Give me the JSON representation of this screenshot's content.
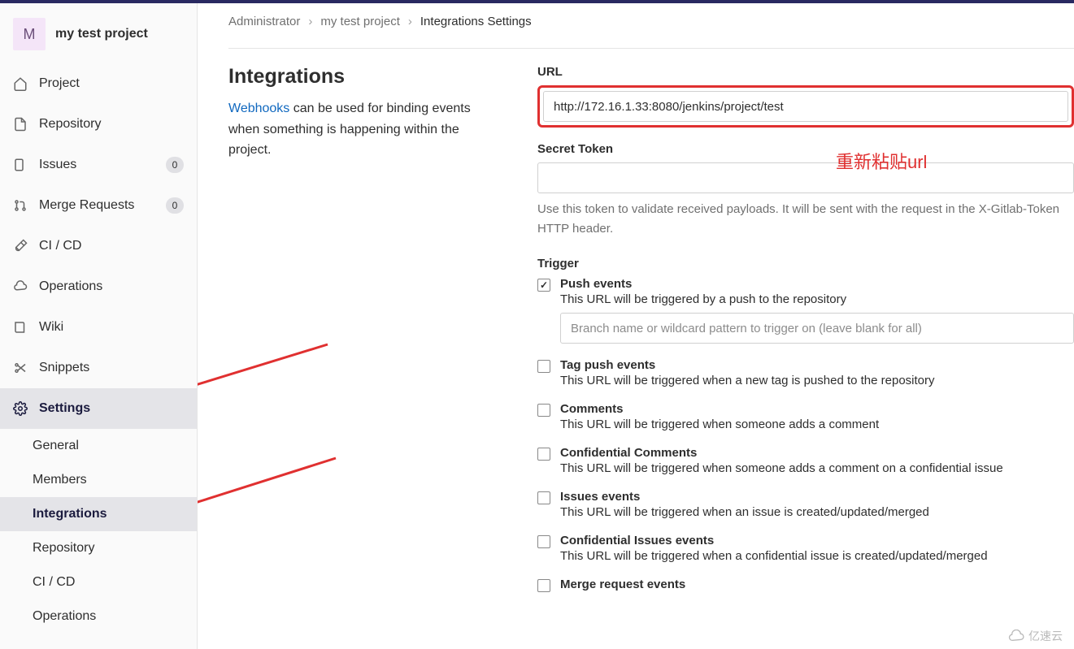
{
  "project": {
    "avatar_letter": "M",
    "name": "my test project"
  },
  "nav": {
    "items": [
      {
        "label": "Project"
      },
      {
        "label": "Repository"
      },
      {
        "label": "Issues",
        "badge": "0"
      },
      {
        "label": "Merge Requests",
        "badge": "0"
      },
      {
        "label": "CI / CD"
      },
      {
        "label": "Operations"
      },
      {
        "label": "Wiki"
      },
      {
        "label": "Snippets"
      },
      {
        "label": "Settings"
      }
    ],
    "settings_sub": [
      {
        "label": "General"
      },
      {
        "label": "Members"
      },
      {
        "label": "Integrations"
      },
      {
        "label": "Repository"
      },
      {
        "label": "CI / CD"
      },
      {
        "label": "Operations"
      }
    ]
  },
  "breadcrumbs": {
    "a": "Administrator",
    "b": "my test project",
    "c": "Integrations Settings"
  },
  "page": {
    "title": "Integrations",
    "webhooks_link": "Webhooks",
    "desc_rest": " can be used for binding events when something is happening within the project."
  },
  "form": {
    "url_label": "URL",
    "url_value": "http://172.16.1.33:8080/jenkins/project/test",
    "secret_label": "Secret Token",
    "secret_value": "",
    "secret_help": "Use this token to validate received payloads. It will be sent with the request in the X-Gitlab-Token HTTP header.",
    "trigger_label": "Trigger",
    "triggers": [
      {
        "title": "Push events",
        "desc": "This URL will be triggered by a push to the repository",
        "checked": true,
        "has_input": true,
        "placeholder": "Branch name or wildcard pattern to trigger on (leave blank for all)"
      },
      {
        "title": "Tag push events",
        "desc": "This URL will be triggered when a new tag is pushed to the repository",
        "checked": false
      },
      {
        "title": "Comments",
        "desc": "This URL will be triggered when someone adds a comment",
        "checked": false
      },
      {
        "title": "Confidential Comments",
        "desc": "This URL will be triggered when someone adds a comment on a confidential issue",
        "checked": false
      },
      {
        "title": "Issues events",
        "desc": "This URL will be triggered when an issue is created/updated/merged",
        "checked": false
      },
      {
        "title": "Confidential Issues events",
        "desc": "This URL will be triggered when a confidential issue is created/updated/merged",
        "checked": false
      },
      {
        "title": "Merge request events",
        "desc": "",
        "checked": false
      }
    ]
  },
  "annotation": {
    "text": "重新粘贴url"
  },
  "watermark": {
    "text": "亿速云"
  }
}
